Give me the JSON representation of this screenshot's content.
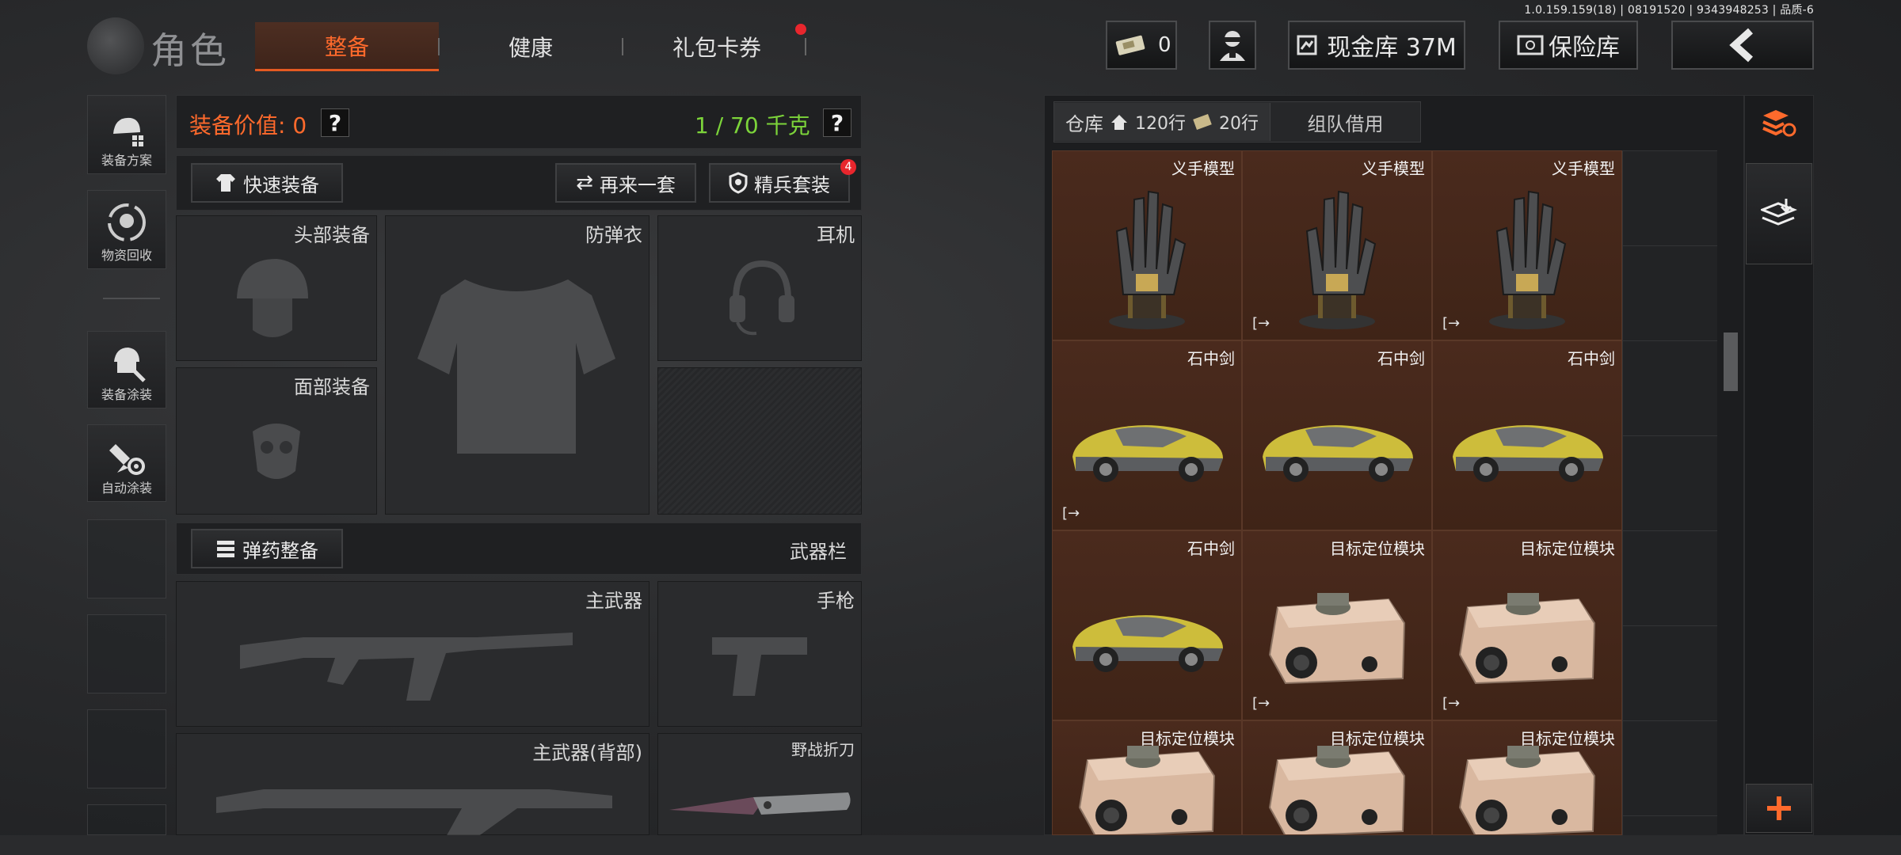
{
  "version": "1.0.159.159(18) | 08191520 | 9343948253 | 品质-6",
  "header": {
    "title": "角色",
    "tabs": [
      {
        "label": "整备",
        "active": true
      },
      {
        "label": "健康",
        "active": false
      },
      {
        "label": "礼包卡券",
        "active": false,
        "badge": true
      }
    ],
    "ticket_count": "0",
    "cash_label": "现金库 37M",
    "safe_label": "保险库"
  },
  "sidebar": {
    "items": [
      {
        "label": "装备方案",
        "icon": "helmet-grid-icon"
      },
      {
        "label": "物资回收",
        "icon": "recycle-icon"
      },
      {
        "label": "装备涂装",
        "icon": "soldier-paint-icon"
      },
      {
        "label": "自动涂装",
        "icon": "brush-gear-icon"
      }
    ]
  },
  "equipment": {
    "value_label": "装备价值: 0",
    "weight_label": "1 / 70 千克",
    "quick_equip": "快速装备",
    "again_label": "再来一套",
    "elite_label": "精兵套装",
    "elite_badge": "4",
    "slots": {
      "head": "头部装备",
      "armor": "防弹衣",
      "headset": "耳机",
      "face": "面部装备"
    },
    "ammo_button": "弹药整备",
    "weapon_bar": "武器栏",
    "weapons": {
      "primary": "主武器",
      "pistol": "手枪",
      "primary_back": "主武器(背部)",
      "knife": "野战折刀"
    }
  },
  "warehouse": {
    "tab_label": "仓库",
    "rows_a": "120行",
    "rows_b": "20行",
    "team_tab": "组队借用",
    "items": [
      {
        "name": "义手模型",
        "icon": "robot-hand-icon",
        "exit": false
      },
      {
        "name": "义手模型",
        "icon": "robot-hand-icon",
        "exit": true
      },
      {
        "name": "义手模型",
        "icon": "robot-hand-icon",
        "exit": true
      },
      {
        "name": "石中剑",
        "icon": "sports-car-icon",
        "exit": true
      },
      {
        "name": "石中剑",
        "icon": "sports-car-icon",
        "exit": false
      },
      {
        "name": "石中剑",
        "icon": "sports-car-icon",
        "exit": false
      },
      {
        "name": "石中剑",
        "icon": "sports-car-icon",
        "exit": false
      },
      {
        "name": "目标定位模块",
        "icon": "targeting-module-icon",
        "exit": true
      },
      {
        "name": "目标定位模块",
        "icon": "targeting-module-icon",
        "exit": true
      },
      {
        "name": "目标定位模块",
        "icon": "targeting-module-icon",
        "exit": false
      },
      {
        "name": "目标定位模块",
        "icon": "targeting-module-icon",
        "exit": false
      },
      {
        "name": "目标定位模块",
        "icon": "targeting-module-icon",
        "exit": false
      }
    ]
  },
  "colors": {
    "accent": "#ff6a2c",
    "weight": "#7cd43a",
    "item_bg": "#4a2a1d",
    "badge": "#e8262d"
  }
}
